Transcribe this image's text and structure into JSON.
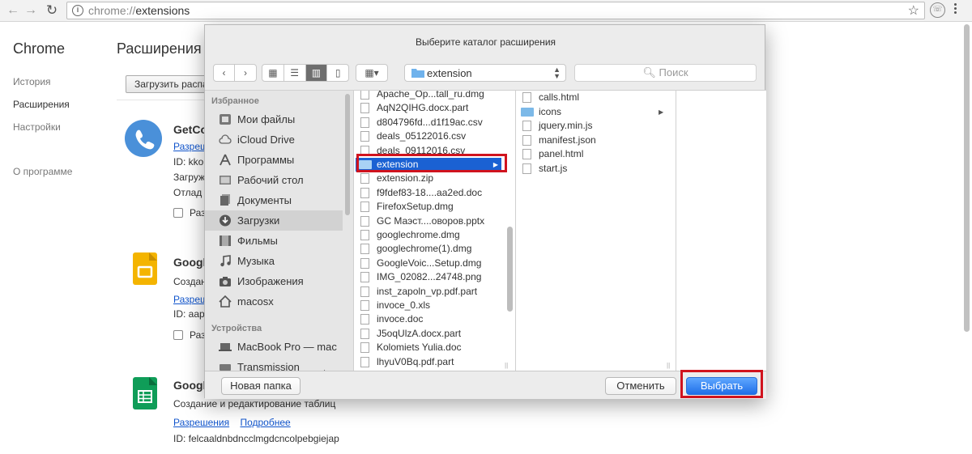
{
  "browser": {
    "url_scheme": "chrome://",
    "url_path": "extensions"
  },
  "chrome_page": {
    "brand": "Chrome",
    "title": "Расширения",
    "sidebar": [
      "История",
      "Расширения",
      "Настройки",
      "О программе"
    ],
    "load_button": "Загрузить распа",
    "extensions": [
      {
        "name": "GetCo",
        "lines": [
          "Разреще",
          "ID: kkol",
          "Загруж",
          "Отлад"
        ],
        "checkbox": "Раз",
        "icon": "phone-icon",
        "color": "#4a90d9"
      },
      {
        "name": "Google",
        "lines": [
          "Создан",
          "Разреше",
          "ID: aap"
        ],
        "checkbox": "Раз",
        "icon": "slides-icon",
        "color": "#f4b400"
      },
      {
        "name": "Google",
        "description": "Создание и редактирование таблиц",
        "permissions": "Разрешения",
        "more": "Подробнее",
        "id_line": "ID: felcaaldnbdncclmgdcncolpebgiejap",
        "icon": "sheets-icon",
        "color": "#0f9d58"
      }
    ]
  },
  "dialog": {
    "title": "Выберите каталог расширения",
    "path": "extension",
    "search_placeholder": "Поиск",
    "favorites_header": "Избранное",
    "favorites": [
      {
        "label": "Мои файлы",
        "icon": "all-files-icon"
      },
      {
        "label": "iCloud Drive",
        "icon": "cloud-icon"
      },
      {
        "label": "Программы",
        "icon": "applications-icon"
      },
      {
        "label": "Рабочий стол",
        "icon": "desktop-icon"
      },
      {
        "label": "Документы",
        "icon": "documents-icon"
      },
      {
        "label": "Загрузки",
        "icon": "downloads-icon"
      },
      {
        "label": "Фильмы",
        "icon": "movies-icon"
      },
      {
        "label": "Музыка",
        "icon": "music-icon"
      },
      {
        "label": "Изображения",
        "icon": "camera-icon"
      },
      {
        "label": "macosx",
        "icon": "home-icon"
      }
    ],
    "devices_header": "Устройства",
    "devices": [
      {
        "label": "MacBook Pro — mac",
        "icon": "laptop-icon"
      },
      {
        "label": "Transmission",
        "icon": "disk-icon"
      }
    ],
    "files": [
      "Apache_Op...tall_ru.dmg",
      "AqN2QIHG.docx.part",
      "d804796fd...d1f19ac.csv",
      "deals_05122016.csv",
      "deals_09112016.csv",
      "extension",
      "extension.zip",
      "f9fdef83-18....aa2ed.doc",
      "FirefoxSetup.dmg",
      "GC Маэст....оворов.pptx",
      "googlechrome.dmg",
      "googlechrome(1).dmg",
      "GoogleVoic...Setup.dmg",
      "IMG_02082...24748.png",
      "inst_zapoln_vp.pdf.part",
      "invoce_0.xls",
      "invoce.doc",
      "J5oqUlzA.docx.part",
      "Kolomiets Yulia.doc",
      "lhyuV0Bq.pdf.part"
    ],
    "selected_file": "extension",
    "subfiles": [
      "calls.html",
      "icons",
      "jquery.min.js",
      "manifest.json",
      "panel.html",
      "start.js"
    ],
    "new_folder": "Новая папка",
    "cancel": "Отменить",
    "choose": "Выбрать"
  }
}
